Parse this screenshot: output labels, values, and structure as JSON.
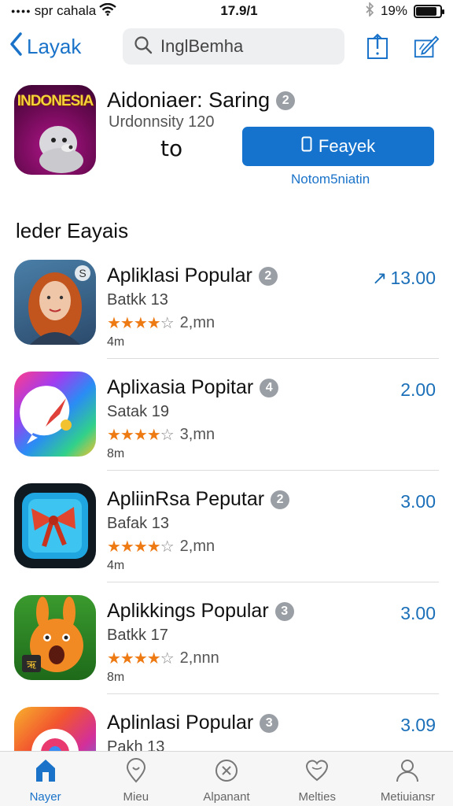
{
  "status_bar": {
    "carrier": "spr cahala",
    "time": "17.9/1",
    "battery": "19%",
    "battery_level": 0.85,
    "icons": [
      "signal-dots-icon",
      "wifi-icon",
      "bluetooth-icon",
      "battery-icon"
    ]
  },
  "nav": {
    "back_label": "Layak",
    "search_placeholder": "InglBemha",
    "icons": [
      "share-icon",
      "compose-icon"
    ]
  },
  "featured": {
    "icon_text": "INDONESIA",
    "title": "Aidoniaer: Saring",
    "title_badge": "2",
    "subtitle": "Urdonnsity 120",
    "count": "to",
    "get_label": "Feayek",
    "link": "Notom5niatin"
  },
  "section": {
    "title": "leder Eayais"
  },
  "apps": [
    {
      "name": "Apliklasi Popular",
      "badge": "2",
      "sub": "Batkk 13",
      "rating": 4.5,
      "count": "2,mn",
      "size": "4m",
      "price": "13.00",
      "price_prefix": "↗"
    },
    {
      "name": "Aplixasia Popitar",
      "badge": "4",
      "sub": "Satak 19",
      "rating": 4.5,
      "count": "3,mn",
      "size": "8m",
      "price": "2.00",
      "price_prefix": ""
    },
    {
      "name": "ApliinRsa Peputar",
      "badge": "2",
      "sub": "Bafak 13",
      "rating": 4.5,
      "count": "2,mn",
      "size": "4m",
      "price": "3.00",
      "price_prefix": ""
    },
    {
      "name": "Aplikkings Popular",
      "badge": "3",
      "sub": "Batkk 17",
      "rating": 4.5,
      "count": "2,nnn",
      "size": "8m",
      "price": "3.00",
      "price_prefix": ""
    },
    {
      "name": "Aplinlasi Popular",
      "badge": "3",
      "sub": "Pakh 13",
      "rating": 0,
      "count": "",
      "size": "",
      "price": "3.09",
      "price_prefix": ""
    }
  ],
  "tabs": [
    {
      "label": "Nayer",
      "icon": "home-icon",
      "active": true
    },
    {
      "label": "Mieu",
      "icon": "location-icon",
      "active": false
    },
    {
      "label": "Alpanant",
      "icon": "close-circle-icon",
      "active": false
    },
    {
      "label": "Melties",
      "icon": "heart-icon",
      "active": false
    },
    {
      "label": "Metiuiansr",
      "icon": "person-icon",
      "active": false
    }
  ],
  "colors": {
    "accent": "#1673cd",
    "star": "#ee7a14",
    "price": "#1a6fb8"
  }
}
